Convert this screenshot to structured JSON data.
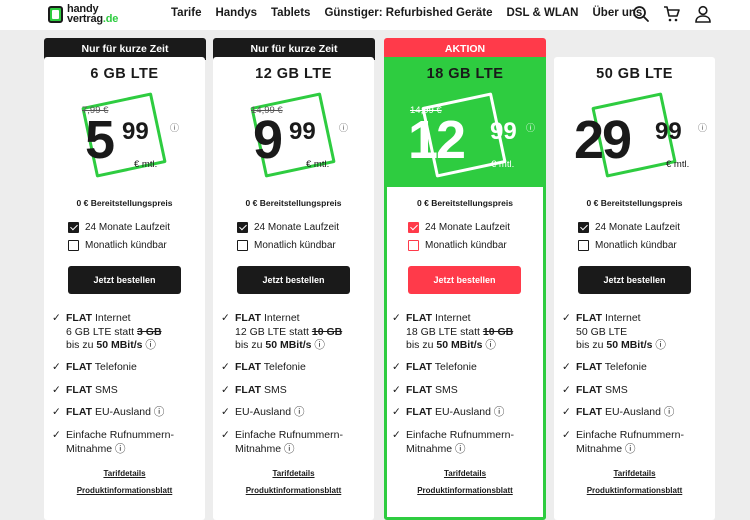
{
  "header": {
    "logo_line1": "handy",
    "logo_line2": "vertrag",
    "logo_tld": ".de",
    "nav": [
      "Tarife",
      "Handys",
      "Tablets",
      "Günstiger: Refurbished Geräte",
      "DSL & WLAN",
      "Über uns"
    ],
    "icons": [
      "search-icon",
      "cart-icon",
      "user-icon"
    ]
  },
  "colors": {
    "brand_green": "#2ecc40",
    "accent_red": "#ff3a4a",
    "dark": "#1a1a1a"
  },
  "cards": [
    {
      "banner": "Nur für kurze Zeit",
      "gb": "6 GB LTE",
      "old_price": "7,99 €",
      "price_main": "5",
      "price_cents": "99",
      "info": "ⓘ",
      "unit": "€ mtl.",
      "setup": "0 € Bereitstellungspreis",
      "opt1": "24 Monate Laufzeit",
      "opt2": "Monatlich kündbar",
      "order": "Jetzt bestellen",
      "f1_flat": "FLAT",
      "f1_rest": " Internet",
      "f1_line2a": "6 GB LTE",
      "f1_line2b": " statt ",
      "f1_strike": "3 GB",
      "f1_line3a": "bis zu ",
      "f1_speed": "50 MBit/s",
      "f1_info": " ⓘ",
      "f2_flat": "FLAT",
      "f2_rest": " Telefonie",
      "f3_flat": "FLAT",
      "f3_rest": " SMS",
      "f4_flat": "FLAT",
      "f4_rest": " EU-Ausland ⓘ",
      "f5_l1": "Einfache Rufnummern-",
      "f5_l2": "Mitnahme ⓘ",
      "link1": "Tarifdetails",
      "link2": "Produktinformationsblatt"
    },
    {
      "banner": "Nur für kurze Zeit",
      "gb": "12 GB LTE",
      "old_price": "14,99 €",
      "price_main": "9",
      "price_cents": "99",
      "info": "ⓘ",
      "unit": "€ mtl.",
      "setup": "0 € Bereitstellungspreis",
      "opt1": "24 Monate Laufzeit",
      "opt2": "Monatlich kündbar",
      "order": "Jetzt bestellen",
      "f1_flat": "FLAT",
      "f1_rest": " Internet",
      "f1_line2a": "12 GB LTE",
      "f1_line2b": " statt ",
      "f1_strike": "10 GB",
      "f1_line3a": "bis zu ",
      "f1_speed": "50 MBit/s",
      "f1_info": " ⓘ",
      "f2_flat": "FLAT",
      "f2_rest": " Telefonie",
      "f3_flat": "FLAT",
      "f3_rest": " SMS",
      "f4_flat": "",
      "f4_rest": "EU-Ausland ⓘ",
      "f5_l1": "Einfache Rufnummern-",
      "f5_l2": "Mitnahme ⓘ",
      "link1": "Tarifdetails",
      "link2": "Produktinformationsblatt"
    },
    {
      "banner": "AKTION",
      "gb": "18 GB LTE",
      "old_price": "14,99 €",
      "price_main": "12",
      "price_cents": "99",
      "info": "ⓘ",
      "unit": "€ mtl.",
      "setup": "0 € Bereitstellungspreis",
      "opt1": "24 Monate Laufzeit",
      "opt2": "Monatlich kündbar",
      "order": "Jetzt bestellen",
      "f1_flat": "FLAT",
      "f1_rest": " Internet",
      "f1_line2a": "18 GB LTE",
      "f1_line2b": " statt ",
      "f1_strike": "10 GB",
      "f1_line3a": "bis zu ",
      "f1_speed": "50 MBit/s",
      "f1_info": " ⓘ",
      "f2_flat": "FLAT",
      "f2_rest": " Telefonie",
      "f3_flat": "FLAT",
      "f3_rest": " SMS",
      "f4_flat": "FLAT",
      "f4_rest": " EU-Ausland ⓘ",
      "f5_l1": "Einfache Rufnummern-",
      "f5_l2": "Mitnahme ⓘ",
      "link1": "Tarifdetails",
      "link2": "Produktinformationsblatt"
    },
    {
      "banner": "",
      "gb": "50 GB LTE",
      "old_price": "",
      "price_main": "29",
      "price_cents": "99",
      "info": "ⓘ",
      "unit": "€ mtl.",
      "setup": "0 € Bereitstellungspreis",
      "opt1": "24 Monate Laufzeit",
      "opt2": "Monatlich kündbar",
      "order": "Jetzt bestellen",
      "f1_flat": "FLAT",
      "f1_rest": " Internet",
      "f1_line2a": "50 GB LTE",
      "f1_line2b": "",
      "f1_strike": "",
      "f1_line3a": "bis zu ",
      "f1_speed": "50 MBit/s",
      "f1_info": " ⓘ",
      "f2_flat": "FLAT",
      "f2_rest": " Telefonie",
      "f3_flat": "FLAT",
      "f3_rest": " SMS",
      "f4_flat": "FLAT",
      "f4_rest": " EU-Ausland ⓘ",
      "f5_l1": "Einfache Rufnummern-",
      "f5_l2": "Mitnahme ⓘ",
      "link1": "Tarifdetails",
      "link2": "Produktinformationsblatt"
    }
  ]
}
